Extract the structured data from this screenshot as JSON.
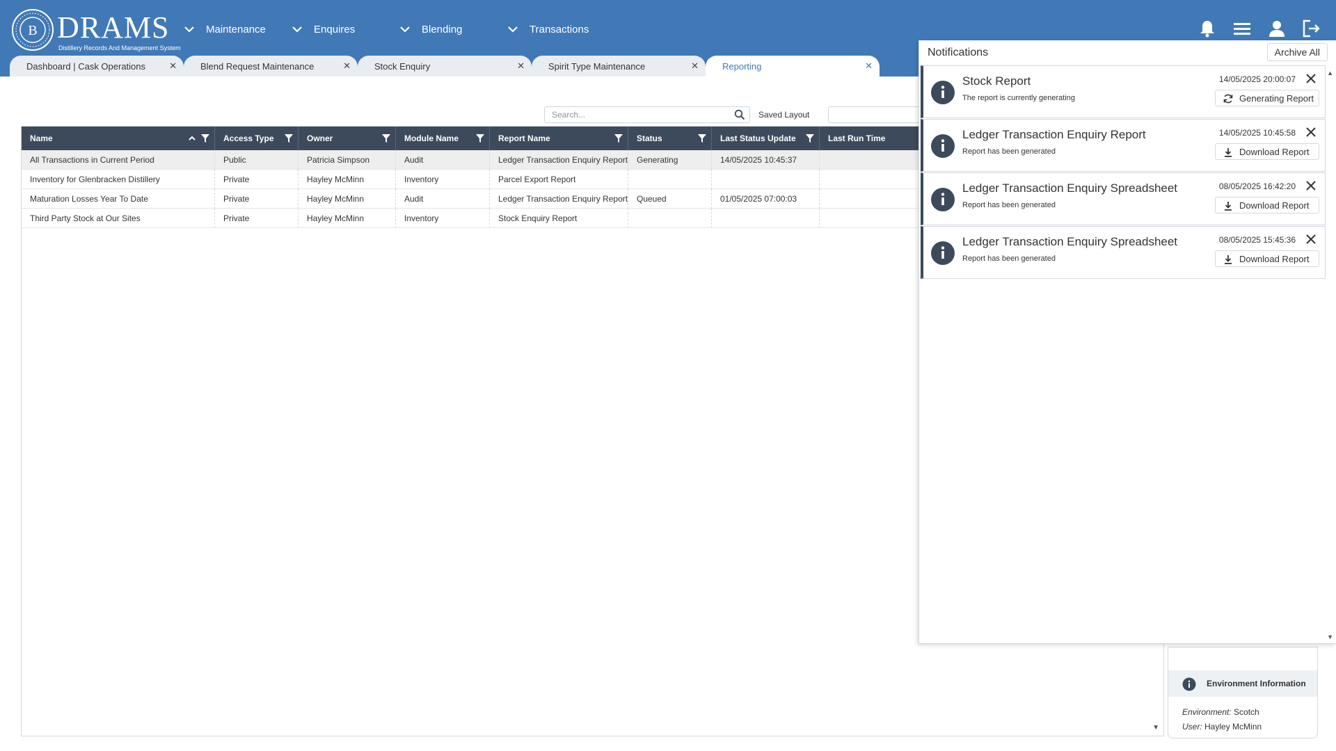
{
  "app": {
    "logo_title": "DRAMS",
    "logo_subtitle": "Distillery Records And Management System"
  },
  "nav": [
    {
      "label": "Maintenance"
    },
    {
      "label": "Enquires"
    },
    {
      "label": "Blending"
    },
    {
      "label": "Transactions"
    }
  ],
  "header_icons": [
    "bell-icon",
    "menu-icon",
    "user-icon",
    "logout-icon"
  ],
  "tabs": [
    {
      "label": "Dashboard | Cask Operations",
      "active": false
    },
    {
      "label": "Blend Request Maintenance",
      "active": false
    },
    {
      "label": "Stock Enquiry",
      "active": false
    },
    {
      "label": "Spirit Type Maintenance",
      "active": false
    },
    {
      "label": "Reporting",
      "active": true
    }
  ],
  "tab_close_glyph": "✕",
  "toolbar": {
    "search_placeholder": "Search...",
    "saved_layout_label": "Saved Layout"
  },
  "grid": {
    "columns": [
      "Name",
      "Access Type",
      "Owner",
      "Module Name",
      "Report Name",
      "Status",
      "Last Status Update",
      "Last Run Time"
    ],
    "rows": [
      [
        "All Transactions in Current Period",
        "Public",
        "Patricia Simpson",
        "Audit",
        "Ledger Transaction Enquiry Report",
        "Generating",
        "14/05/2025 10:45:37",
        ""
      ],
      [
        "Inventory for Glenbracken Distillery",
        "Private",
        "Hayley McMinn",
        "Inventory",
        "Parcel Export Report",
        "",
        "",
        ""
      ],
      [
        "Maturation Losses Year To Date",
        "Private",
        "Hayley McMinn",
        "Audit",
        "Ledger Transaction Enquiry Report",
        "Queued",
        "01/05/2025 07:00:03",
        ""
      ],
      [
        "Third Party Stock at Our Sites",
        "Private",
        "Hayley McMinn",
        "Inventory",
        "Stock Enquiry Report",
        "",
        "",
        ""
      ]
    ],
    "selected_row": 0
  },
  "environment": {
    "title": "Environment Information",
    "environment_label": "Environment:",
    "environment_value": "Scotch",
    "user_label": "User:",
    "user_value": "Hayley McMinn"
  },
  "notifications": {
    "title": "Notifications",
    "archive_all_label": "Archive All",
    "items": [
      {
        "title": "Stock Report",
        "message": "The report is currently generating",
        "date": "14/05/2025 20:00:07",
        "button": "Generating Report",
        "button_icon": "refresh-icon"
      },
      {
        "title": "Ledger Transaction Enquiry Report",
        "message": "Report has been generated",
        "date": "14/05/2025 10:45:58",
        "button": "Download Report",
        "button_icon": "download-icon"
      },
      {
        "title": "Ledger Transaction Enquiry Spreadsheet",
        "message": "Report has been generated",
        "date": "08/05/2025 16:42:20",
        "button": "Download Report",
        "button_icon": "download-icon"
      },
      {
        "title": "Ledger Transaction Enquiry Spreadsheet",
        "message": "Report has been generated",
        "date": "08/05/2025 15:45:36",
        "button": "Download Report",
        "button_icon": "download-icon"
      }
    ]
  },
  "colors": {
    "header_bg": "#4179b6",
    "grid_header_bg": "#3d4a5c",
    "active_tab_text": "#4179b6"
  }
}
